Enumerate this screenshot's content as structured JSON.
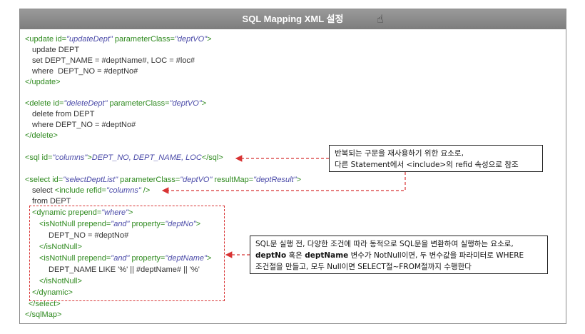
{
  "title": "SQL Mapping XML 설정",
  "code": {
    "update": {
      "open_tag": "<update ",
      "id_attr": "id=",
      "id_val": "\"updateDept\"",
      "pc_attr": " parameterClass=",
      "pc_val": "\"deptVO\"",
      "close_bracket": ">",
      "line1": "update DEPT",
      "line2": "set DEPT_NAME = #deptName#, LOC = #loc#",
      "line3": "where  DEPT_NO = #deptNo#",
      "end_tag": "</update>"
    },
    "delete": {
      "open_tag": "<delete ",
      "id_attr": "id=",
      "id_val": "\"deleteDept\"",
      "pc_attr": " parameterClass=",
      "pc_val": "\"deptVO\"",
      "close_bracket": ">",
      "line1": "delete from DEPT",
      "line2": "where DEPT_NO = #deptNo#",
      "end_tag": "</delete>"
    },
    "sql": {
      "open_tag": "<sql ",
      "id_attr": "id=",
      "id_val": "\"columns\"",
      "close_bracket": ">",
      "body": "DEPT_NO, DEPT_NAME, LOC",
      "end_tag": "</sql>"
    },
    "select": {
      "open_tag": "<select ",
      "id_attr": "id=",
      "id_val": "\"selectDeptList\"",
      "pc_attr": " parameterClass=",
      "pc_val": "\"deptVO\"",
      "rm_attr": " resultMap=",
      "rm_val": "\"deptResult\"",
      "close_bracket": ">",
      "line1_prefix": "select ",
      "include_tag": "<include ",
      "refid_attr": "refid=",
      "refid_val": "\"columns\"",
      "include_close": " />",
      "line2": "from DEPT",
      "end_tag": "</select>"
    },
    "dynamic": {
      "open_tag": "<dynamic ",
      "prepend_attr": "prepend=",
      "prepend_val": "\"where\"",
      "close_bracket": ">",
      "nn1_open": "<isNotNull ",
      "nn1_prepend_attr": "prepend=",
      "nn1_prepend_val": "\"and\"",
      "nn1_prop_attr": " property=",
      "nn1_prop_val": "\"deptNo\"",
      "nn1_close_bracket": ">",
      "nn1_body": "DEPT_NO = #deptNo#",
      "nn1_end": "</isNotNull>",
      "nn2_open": "<isNotNull ",
      "nn2_prepend_attr": "prepend=",
      "nn2_prepend_val": "\"and\"",
      "nn2_prop_attr": " property=",
      "nn2_prop_val": "\"deptName\"",
      "nn2_close_bracket": ">",
      "nn2_body": "DEPT_NAME LIKE '%' || #deptName# || '%'",
      "nn2_end": "</isNotNull>",
      "end_tag": "</dynamic>"
    },
    "sqlmap_end": "</sqlMap>"
  },
  "callouts": {
    "sql_note": {
      "line1": "반복되는 구문을 재사용하기 위한 요소로,",
      "line2": "다른 Statement에서 <include>의 refid 속성으로 참조"
    },
    "dynamic_note": {
      "line1": "SQL문 실행 전, 다양한 조건에 따라 동적으로 SQL문을 변환하여 실행하는 요소로,",
      "line2_b1": "deptNo",
      "line2_t1": " 혹은 ",
      "line2_b2": "deptName",
      "line2_t2": " 변수가 NotNull이면, 두 변수값을 파라미터로 WHERE",
      "line3": "조건절을 만들고, 모두 Null이면 SELECT절~FROM절까지 수행한다"
    }
  },
  "colors": {
    "tag": "#2f8a1f",
    "value": "#4a4aa8",
    "text": "#333333",
    "dash": "#d83333",
    "titlebar": "#8a8a8a"
  },
  "icons": [
    "hand-cursor-icon"
  ]
}
